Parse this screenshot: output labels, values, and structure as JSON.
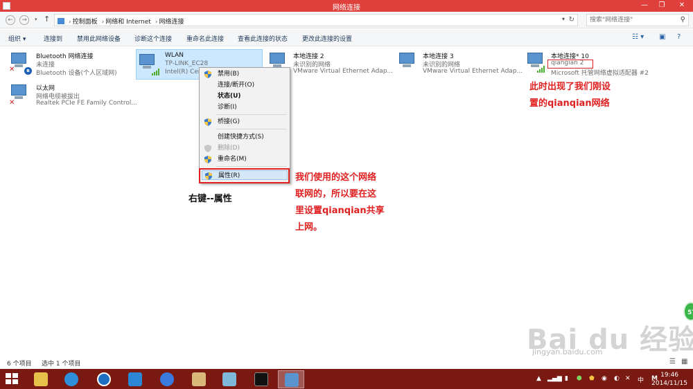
{
  "window": {
    "title": "网络连接",
    "minimize_glyph": "—",
    "restore_glyph": "❐",
    "close_glyph": "✕"
  },
  "address": {
    "crumbs": [
      "控制面板",
      "网络和 Internet",
      "网络连接"
    ],
    "search_placeholder": "搜索\"网络连接\""
  },
  "commands": [
    "组织 ▾",
    "连接到",
    "禁用此网络设备",
    "诊断这个连接",
    "重命名此连接",
    "查看此连接的状态",
    "更改此连接的设置"
  ],
  "connections": [
    {
      "name": "Bluetooth 网络连接",
      "status": "未连接",
      "device": "Bluetooth 设备(个人区域网)"
    },
    {
      "name": "WLAN",
      "status": "TP-LINK_EC28",
      "device": "Intel(R) Centrino..."
    },
    {
      "name": "本地连接 2",
      "status": "未识别的网络",
      "device": "VMware Virtual Ethernet Adap..."
    },
    {
      "name": "本地连接 3",
      "status": "未识别的网络",
      "device": "VMware Virtual Ethernet Adap..."
    },
    {
      "name": "本地连接* 10",
      "status": "qiangian 2",
      "device": "Microsoft 托管网络虚拟适配器 #2"
    },
    {
      "name": "以太网",
      "status": "网络电缆被拔出",
      "device": "Realtek PCIe FE Family Control..."
    }
  ],
  "context_menu": {
    "items": [
      "禁用(B)",
      "连接/断开(O)",
      "状态(U)",
      "诊断(I)",
      "桥接(G)",
      "创建快捷方式(S)",
      "删除(D)",
      "重命名(M)",
      "属性(R)"
    ]
  },
  "annotations": {
    "right_click": "右键--属性",
    "middle_lines": [
      "我们使用的这个网络",
      "联网的，所以要在这",
      "里设置qianqian共享",
      "上网。"
    ],
    "right_lines": [
      "此时出现了我们刚设",
      "置的qianqian网络"
    ]
  },
  "status_bar": {
    "item_count": "6 个项目",
    "selected": "选中 1 个项目"
  },
  "watermark": {
    "logo": "Bai du 经验",
    "url": "jingyan.baidu.com"
  },
  "side_badge": "57",
  "taskbar": {
    "ime_lang": "中",
    "ime_mode": "M",
    "time": "19:46",
    "date": "2014/11/15"
  },
  "colors": {
    "titlebar": "#e0403c",
    "taskbar": "#7a1812",
    "annotation": "#e02020",
    "selection": "#cce8ff"
  },
  "icons": {
    "nav": [
      "back-arrow-icon",
      "forward-arrow-icon",
      "up-arrow-icon",
      "refresh-icon",
      "search-icon"
    ],
    "menu": [
      "shield-icon"
    ]
  }
}
